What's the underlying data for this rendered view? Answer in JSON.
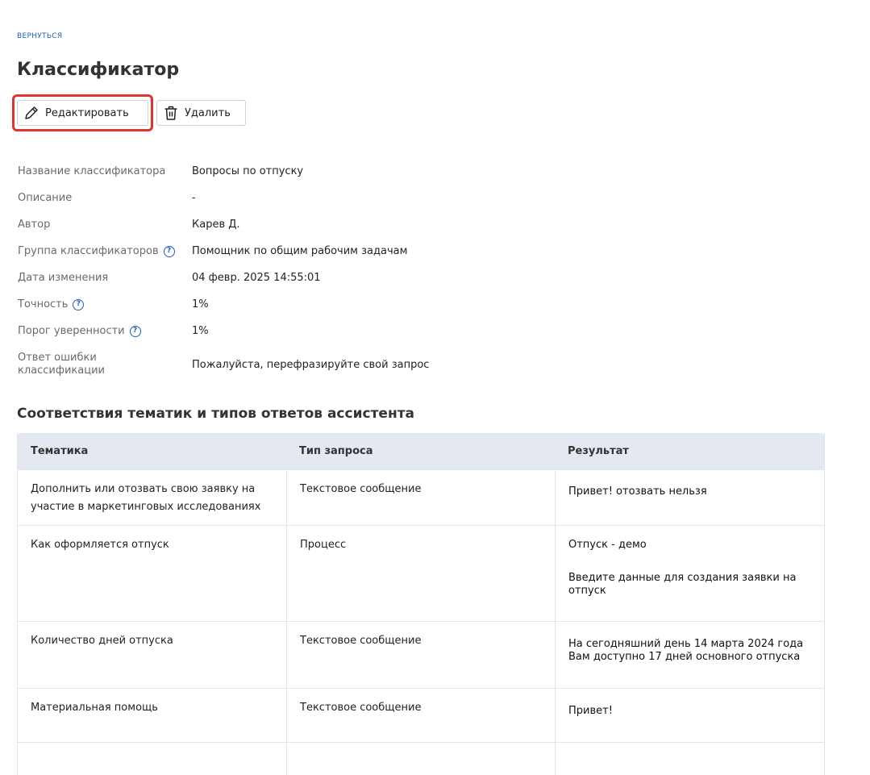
{
  "nav": {
    "back_label": "ВЕРНУТЬСЯ"
  },
  "page": {
    "title": "Классификатор"
  },
  "toolbar": {
    "edit_label": "Редактировать",
    "delete_label": "Удалить"
  },
  "properties": {
    "name": {
      "label": "Название классификатора",
      "value": "Вопросы по отпуску"
    },
    "description": {
      "label": "Описание",
      "value": "-"
    },
    "author": {
      "label": "Автор",
      "value": "Карев Д."
    },
    "group": {
      "label": "Группа классификаторов",
      "value": "Помощник по общим рабочим задачам"
    },
    "modified": {
      "label": "Дата изменения",
      "value": "04 февр. 2025 14:55:01"
    },
    "accuracy": {
      "label": "Точность",
      "value": "1%"
    },
    "threshold": {
      "label": "Порог уверенности",
      "value": "1%"
    },
    "error_answer": {
      "label_line1": "Ответ ошибки",
      "label_line2": "классификации",
      "value": "Пожалуйста, перефразируйте свой запрос"
    }
  },
  "help_glyph": "?",
  "section": {
    "title": "Соответствия тематик и типов ответов ассистента"
  },
  "table": {
    "headers": [
      "Тематика",
      "Тип запроса",
      "Результат"
    ],
    "rows": [
      {
        "topic": "Дополнить или отозвать свою заявку на участие в маркетинговых исследованиях",
        "type": "Текстовое сообщение",
        "result_1": "Привет! отозвать нельзя",
        "result_2": ""
      },
      {
        "topic": "Как оформляется отпуск",
        "type": "Процесс",
        "result_1": "Отпуск - демо",
        "result_2": "Введите данные для создания заявки на отпуск"
      },
      {
        "topic": "Количество дней отпуска",
        "type": "Текстовое сообщение",
        "result_1": "На сегодняшний день 14 марта 2024 года Вам доступно 17 дней основного отпуска",
        "result_2": ""
      },
      {
        "topic": "Материальная помощь",
        "type": "Текстовое сообщение",
        "result_1": "Привет!",
        "result_2": ""
      }
    ]
  },
  "colors": {
    "accent": "#1f5fb8",
    "highlight": "#e0342e",
    "header_bg": "#e4e9f1"
  },
  "icons": {
    "edit": "pencil-icon",
    "delete": "trash-icon",
    "help": "question-circle-icon"
  }
}
